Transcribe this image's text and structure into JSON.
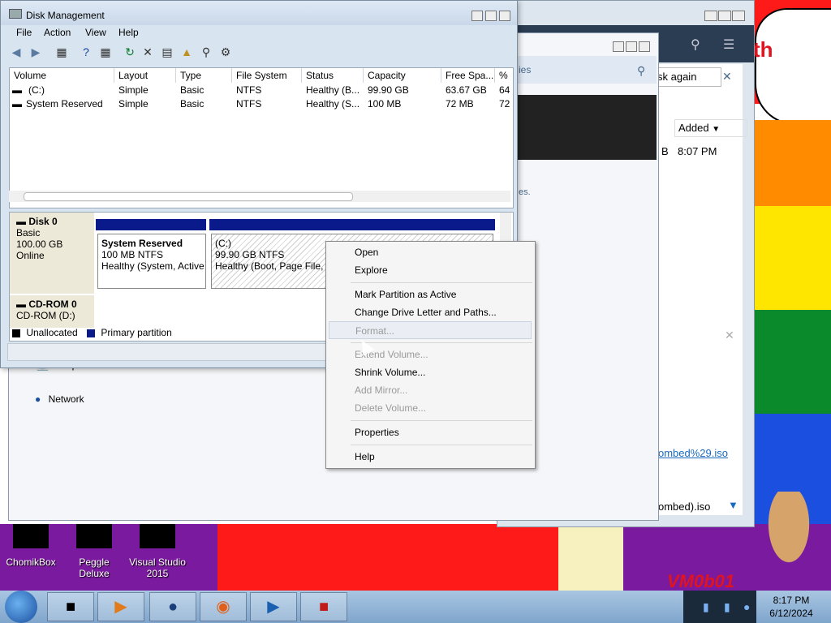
{
  "colors": {
    "accent": "#0a1a8a",
    "taskbar": "#8fb2d6"
  },
  "dm": {
    "title": "Disk Management",
    "menu": [
      "File",
      "Action",
      "View",
      "Help"
    ],
    "columns": [
      "Volume",
      "Layout",
      "Type",
      "File System",
      "Status",
      "Capacity",
      "Free Spa...",
      "%"
    ],
    "rows": [
      [
        "(C:)",
        "Simple",
        "Basic",
        "NTFS",
        "Healthy (B...",
        "99.90 GB",
        "63.67 GB",
        "64"
      ],
      [
        "System Reserved",
        "Simple",
        "Basic",
        "NTFS",
        "Healthy (S...",
        "100 MB",
        "72 MB",
        "72"
      ]
    ],
    "disk0": {
      "name": "Disk 0",
      "type": "Basic",
      "size": "100.00 GB",
      "status": "Online",
      "partitions": [
        {
          "label": "System Reserved",
          "size": "100 MB NTFS",
          "status": "Healthy (System, Active"
        },
        {
          "label": "(C:)",
          "size": "99.90 GB NTFS",
          "status": "Healthy (Boot, Page File, C"
        }
      ]
    },
    "cdrom": {
      "name": "CD-ROM 0",
      "drive": "CD-ROM (D:)"
    },
    "legend": {
      "unallocated": "Unallocated",
      "primary": "Primary partition"
    }
  },
  "context_menu": {
    "items": [
      {
        "label": "Open",
        "disabled": false
      },
      {
        "label": "Explore",
        "disabled": false
      },
      {
        "label": "Mark Partition as Active",
        "disabled": false
      },
      {
        "label": "Change Drive Letter and Paths...",
        "disabled": false
      },
      {
        "label": "Format...",
        "disabled": true
      },
      {
        "label": "Extend Volume...",
        "disabled": true
      },
      {
        "label": "Shrink Volume...",
        "disabled": false
      },
      {
        "label": "Add Mirror...",
        "disabled": true
      },
      {
        "label": "Delete Volume...",
        "disabled": true
      },
      {
        "label": "Properties",
        "disabled": false
      },
      {
        "label": "Help",
        "disabled": false
      }
    ]
  },
  "background": {
    "browser_tab": "sk again",
    "added_header": "Added",
    "added_time": "8:07 PM",
    "added_prefix": "B",
    "link_text": "ombed%29.iso",
    "download_name": "ombed).iso",
    "red_text": "th",
    "explorer_frag_1": "ies",
    "explorer_frag_2": "es.",
    "computer": "Computer",
    "network": "Network"
  },
  "desktop_icons": [
    "ChomikBox",
    "Peggle Deluxe",
    "Visual Studio 2015"
  ],
  "watermark": "VM0b01",
  "clock": {
    "time": "8:17 PM",
    "date": "6/12/2024"
  }
}
